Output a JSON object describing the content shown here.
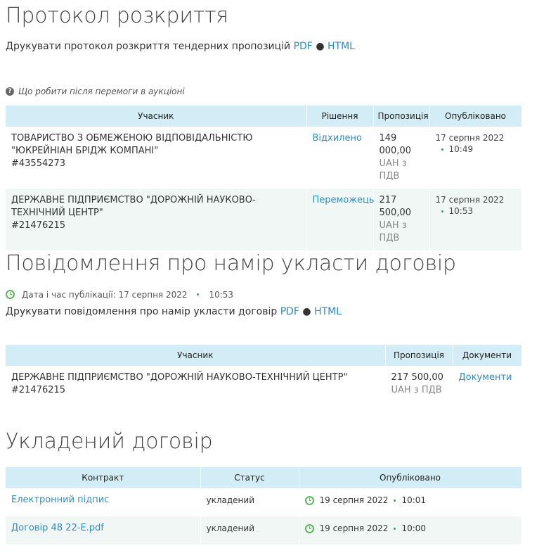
{
  "protocol": {
    "title": "Протокол розкриття",
    "print_text": "Друкувати протокол розкриття тендерних пропозицій",
    "pdf_label": "PDF",
    "sep": "●",
    "html_label": "HTML",
    "help_link": "Що робити після перемоги в аукціоні",
    "headers": {
      "participant": "Учасник",
      "decision": "Рішення",
      "proposal": "Пропозиція",
      "published": "Опубліковано"
    },
    "rows": [
      {
        "name": "ТОВАРИСТВО З ОБМЕЖЕНОЮ ВІДПОВІДАЛЬНІСТЮ \"ЮКРЕЙНІАН БРІДЖ КОМПАНІ\"",
        "code": "#43554273",
        "decision": "Відхилено",
        "amount": "149 000,00",
        "unit": "UAH з ПДВ",
        "date": "17 серпня 2022",
        "time": "10:49"
      },
      {
        "name": "ДЕРЖАВНЕ ПІДПРИЄМСТВО \"ДОРОЖНІЙ НАУКОВО-ТЕХНІЧНИЙ ЦЕНТР\"",
        "code": "#21476215",
        "decision": "Переможець",
        "amount": "217 500,00",
        "unit": "UAH з ПДВ",
        "date": "17 серпня 2022",
        "time": "10:53"
      }
    ]
  },
  "notice": {
    "title": "Повідомлення про намір укласти договір",
    "pub_label": "Дата і час публікації: 17 серпня 2022",
    "pub_time": "10:53",
    "print_text": "Друкувати повідомлення про намір укласти договір",
    "pdf_label": "PDF",
    "sep": "●",
    "html_label": "HTML",
    "headers": {
      "participant": "Учасник",
      "proposal": "Пропозиція",
      "documents": "Документи"
    },
    "row": {
      "name": "ДЕРЖАВНЕ ПІДПРИЄМСТВО \"ДОРОЖНІЙ НАУКОВО-ТЕХНІЧНИЙ ЦЕНТР\"",
      "code": "#21476215",
      "amount": "217 500,00",
      "unit": "UAH з ПДВ",
      "documents": "Документи"
    }
  },
  "contract": {
    "title": "Укладений договір",
    "headers": {
      "contract": "Контракт",
      "status": "Статус",
      "published": "Опубліковано"
    },
    "rows": [
      {
        "name": "Електронний підпис",
        "status": "укладений",
        "date": "19 серпня 2022",
        "time": "10:01"
      },
      {
        "name": "Договір 48 22-Е.pdf",
        "status": "укладений",
        "date": "19 серпня 2022",
        "time": "10:00"
      }
    ]
  },
  "colors": {
    "accent": "#2e8cc4",
    "header_bg": "#d2edf5",
    "alt_row": "#f1f7f5",
    "clock": "#5cb85c"
  }
}
